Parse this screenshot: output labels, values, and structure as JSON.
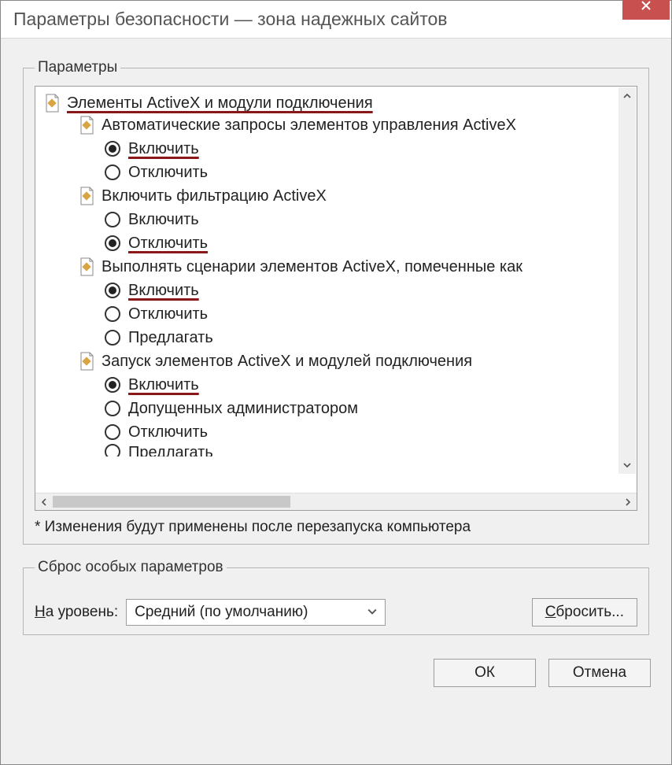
{
  "window": {
    "title": "Параметры безопасности — зона надежных сайтов"
  },
  "group_settings": {
    "legend": "Параметры",
    "note": "* Изменения будут применены после перезапуска компьютера"
  },
  "tree": {
    "category": {
      "label": "Элементы ActiveX и модули подключения",
      "highlight": true
    },
    "items": [
      {
        "label": "Автоматические запросы элементов управления ActiveX",
        "options": [
          {
            "label": "Включить",
            "checked": true,
            "highlight": true
          },
          {
            "label": "Отключить",
            "checked": false,
            "highlight": false
          }
        ]
      },
      {
        "label": "Включить фильтрацию ActiveX",
        "options": [
          {
            "label": "Включить",
            "checked": false,
            "highlight": false
          },
          {
            "label": "Отключить",
            "checked": true,
            "highlight": true
          }
        ]
      },
      {
        "label": "Выполнять сценарии элементов ActiveX, помеченные как",
        "options": [
          {
            "label": "Включить",
            "checked": true,
            "highlight": true
          },
          {
            "label": "Отключить",
            "checked": false,
            "highlight": false
          },
          {
            "label": "Предлагать",
            "checked": false,
            "highlight": false
          }
        ]
      },
      {
        "label": "Запуск элементов ActiveX и модулей подключения",
        "options": [
          {
            "label": "Включить",
            "checked": true,
            "highlight": true
          },
          {
            "label": "Допущенных администратором",
            "checked": false,
            "highlight": false
          },
          {
            "label": "Отключить",
            "checked": false,
            "highlight": false
          },
          {
            "label": "Предлагать",
            "checked": false,
            "highlight": false,
            "cut": true
          }
        ]
      }
    ]
  },
  "reset": {
    "legend": "Сброс особых параметров",
    "level_label": "На уровень:",
    "level_value": "Средний (по умолчанию)",
    "reset_button": "Сбросить..."
  },
  "buttons": {
    "ok": "ОК",
    "cancel": "Отмена"
  }
}
